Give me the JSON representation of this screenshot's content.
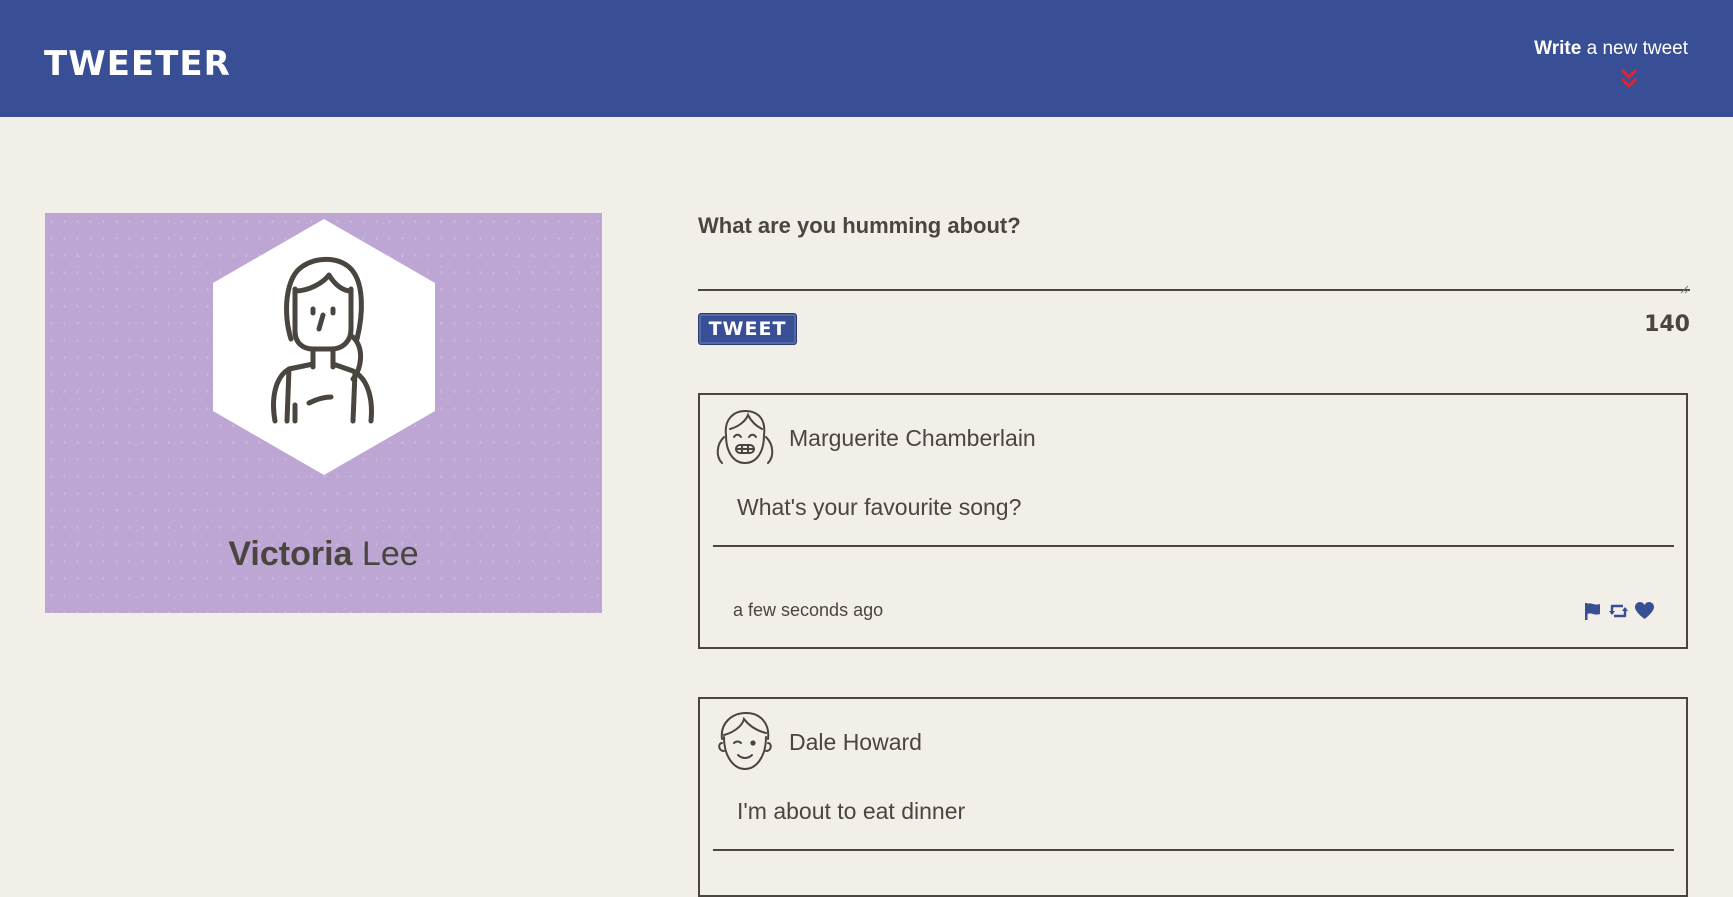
{
  "nav": {
    "brand": "Tweeter",
    "compose_bold": "Write",
    "compose_rest": " a new tweet",
    "chevron_icon": "double-chevron-down-icon",
    "chevron_color": "#e0242f"
  },
  "profile": {
    "first_name": "Victoria",
    "last_name": "Lee",
    "avatar_icon": "woman-avatar-icon",
    "card_color": "#bda6d4"
  },
  "composer": {
    "prompt": "What are you humming about?",
    "textarea_value": "",
    "tweet_button": "TWEET",
    "char_count": "140"
  },
  "tweets": [
    {
      "author": "Marguerite Chamberlain",
      "avatar_icon": "girl-smiling-avatar-icon",
      "body": "What's your favourite song?",
      "time": "a few seconds ago",
      "actions": [
        "flag-icon",
        "retweet-icon",
        "heart-icon"
      ]
    },
    {
      "author": "Dale Howard",
      "avatar_icon": "boy-winking-avatar-icon",
      "body": "I'm about to eat dinner"
    }
  ],
  "colors": {
    "nav": "#384f96",
    "background": "#f2efe8",
    "text": "#4a453f",
    "action_icons": "#384f96"
  }
}
